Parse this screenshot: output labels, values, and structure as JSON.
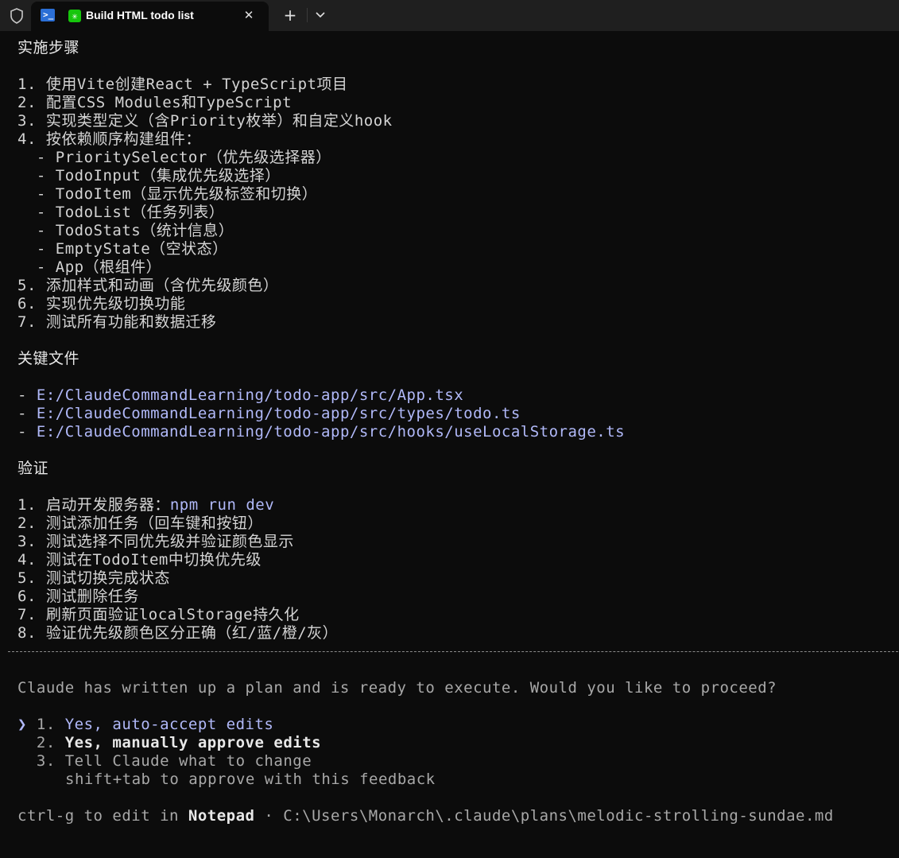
{
  "window": {
    "tab_title": "Build HTML todo list",
    "new_tab_glyph": "+",
    "close_glyph": "✕",
    "icons": [
      "shield-icon",
      "powershell-icon",
      "claude-icon",
      "close-icon",
      "plus-icon",
      "chevron-down-icon"
    ]
  },
  "plan": {
    "steps_heading": "实施步骤",
    "steps": [
      "1. 使用Vite创建React + TypeScript项目",
      "2. 配置CSS Modules和TypeScript",
      "3. 实现类型定义（含Priority枚举）和自定义hook",
      "4. 按依赖顺序构建组件：",
      "  - PrioritySelector（优先级选择器）",
      "  - TodoInput（集成优先级选择）",
      "  - TodoItem（显示优先级标签和切换）",
      "  - TodoList（任务列表）",
      "  - TodoStats（统计信息）",
      "  - EmptyState（空状态）",
      "  - App（根组件）",
      "5. 添加样式和动画（含优先级颜色）",
      "6. 实现优先级切换功能",
      "7. 测试所有功能和数据迁移"
    ],
    "files_heading": "关键文件",
    "files": [
      {
        "bullet": "- ",
        "path": "E:/ClaudeCommandLearning/todo-app/src/App.tsx"
      },
      {
        "bullet": "- ",
        "path": "E:/ClaudeCommandLearning/todo-app/src/types/todo.ts"
      },
      {
        "bullet": "- ",
        "path": "E:/ClaudeCommandLearning/todo-app/src/hooks/useLocalStorage.ts"
      }
    ],
    "verify_heading": "验证",
    "verify_first_prefix": "1. 启动开发服务器：",
    "verify_first_cmd": "npm run dev",
    "verify_steps": [
      "2. 测试添加任务（回车键和按钮）",
      "3. 测试选择不同优先级并验证颜色显示",
      "4. 测试在TodoItem中切换优先级",
      "5. 测试切换完成状态",
      "6. 测试删除任务",
      "7. 刷新页面验证localStorage持久化",
      "8. 验证优先级颜色区分正确（红/蓝/橙/灰）"
    ]
  },
  "prompt": {
    "question": "Claude has written up a plan and is ready to execute. Would you like to proceed?",
    "pointer": "❯ ",
    "options": [
      {
        "number": "1. ",
        "label": "Yes, auto-accept edits",
        "selected": true
      },
      {
        "number": "2. ",
        "label": "Yes, manually approve edits",
        "selected": false
      },
      {
        "number": "3. ",
        "label": "Tell Claude what to change",
        "selected": false
      }
    ],
    "option3_hint": "shift+tab to approve with this feedback",
    "footer_prefix": "ctrl-g to edit in ",
    "footer_editor": "Notepad",
    "footer_suffix": " · C:\\Users\\Monarch\\.claude\\plans\\melodic-strolling-sundae.md"
  },
  "colors": {
    "background": "#0c0c0c",
    "titlebar": "#1f1f1f",
    "text": "#d4d4d4",
    "accent": "#b1b9f9",
    "muted": "#a8a8a8"
  }
}
